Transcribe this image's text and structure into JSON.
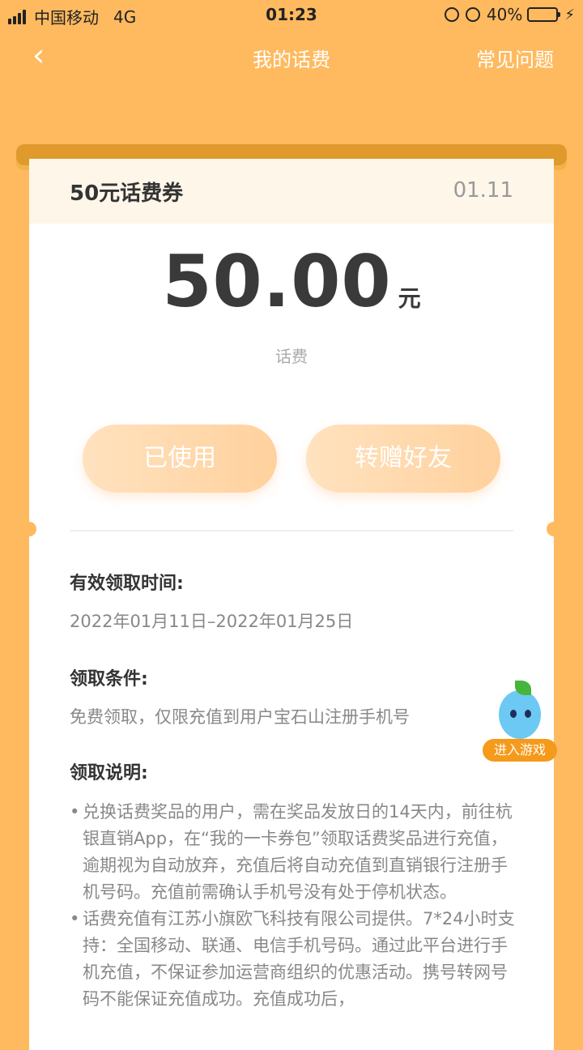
{
  "status_bar": {
    "carrier": "中国移动",
    "network": "4G",
    "time": "01:23",
    "battery": "40%",
    "battery_level": 0.4
  },
  "nav": {
    "back_icon": "chevron-left-icon",
    "title": "我的话费",
    "faq": "常见问题"
  },
  "coupon": {
    "name": "50元话费券",
    "date": "01.11",
    "amount": "50.00",
    "unit": "元",
    "subtitle": "话费",
    "used_button": "已使用",
    "gift_button": "转赠好友"
  },
  "sections": {
    "valid_title": "有效领取时间:",
    "valid_text": "2022年01月11日–2022年01月25日",
    "condition_title": "领取条件:",
    "condition_text": "免费领取，仅限充值到用户宝石山注册手机号",
    "desc_title": "领取说明:",
    "notes": [
      "兑换话费奖品的用户，需在奖品发放日的14天内，前往杭银直销App，在“我的一卡券包”领取话费奖品进行充值，逾期视为自动放弃，充值后将自动充值到直销银行注册手机号码。充值前需确认手机号没有处于停机状态。",
      "话费充值有江苏小旗欧飞科技有限公司提供。7*24小时支持：全国移动、联通、电信手机号码。通过此平台进行手机充值，不保证参加运营商组织的优惠活动。携号转网号码不能保证充值成功。充值成功后，"
    ]
  },
  "floating": {
    "game_button": "进入游戏"
  },
  "colors": {
    "background": "#FFBA5F",
    "card_header": "#FFF6EA",
    "button": "#FFD9AE"
  }
}
